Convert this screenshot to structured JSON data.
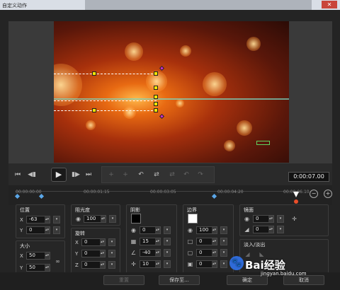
{
  "window": {
    "title": "自定义动作",
    "close_glyph": "✕"
  },
  "transport": {
    "timecode": "0:00:07.00",
    "buttons": [
      "⏮",
      "◀▮",
      "▶",
      "▮▶",
      "⏭"
    ],
    "tool_icons": [
      "+",
      "+",
      "↶",
      "⇄",
      "⇄",
      "↶",
      "↷"
    ]
  },
  "timeline": {
    "ticks": [
      "00:00:00:00",
      "00:00:01:15",
      "00:00:03:05",
      "00:00:04:20",
      "00:00:06:10"
    ],
    "zoom_out": "−",
    "zoom_in": "+"
  },
  "position": {
    "title": "位置",
    "x_label": "X",
    "x_value": "-63",
    "y_label": "Y",
    "y_value": "0"
  },
  "size": {
    "title": "大小",
    "x_label": "X",
    "x_value": "50",
    "y_label": "Y",
    "y_value": "50"
  },
  "opacity": {
    "title": "阻光度",
    "value": "100"
  },
  "rotation": {
    "title": "旋转",
    "x_label": "X",
    "x_value": "0",
    "y_label": "Y",
    "y_value": "0",
    "z_label": "Z",
    "z_value": "0"
  },
  "shadow": {
    "title": "阴影",
    "color": "#000000",
    "v1": "0",
    "v2": "15",
    "v3": "-40",
    "v4": "10"
  },
  "border": {
    "title": "边界",
    "color": "#ffffff",
    "v1": "100",
    "v2": "0",
    "v3": "0",
    "v4": "0"
  },
  "mirror": {
    "title": "镜面",
    "v1": "0",
    "v2": "0"
  },
  "fade": {
    "title": "淡入/淡出"
  },
  "footer": {
    "reset": "重置",
    "save_as": "保存至...",
    "ok": "确定",
    "cancel": "取消"
  },
  "watermark": {
    "brand": "Bai",
    "brand_icon": "🐾",
    "brand_tail": "经验",
    "url": "jingyan.baidu.com"
  }
}
